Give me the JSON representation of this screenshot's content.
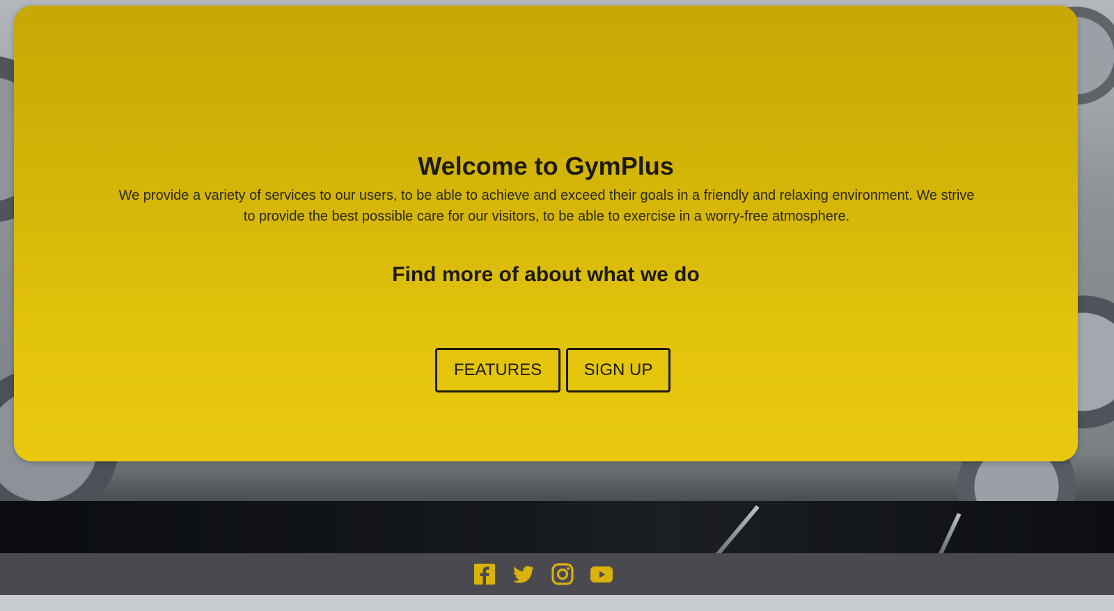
{
  "hero": {
    "title": "Welcome to GymPlus",
    "description": "We provide a variety of services to our users, to be able to achieve and exceed their goals in a friendly and relaxing environment. We strive to provide the best possible care for our visitors, to be able to exercise in a worry-free atmosphere.",
    "subtitle": "Find more of about what we do",
    "buttons": {
      "features": "FEATURES",
      "signup": "SIGN UP"
    }
  },
  "footer": {
    "social": [
      {
        "name": "facebook-icon"
      },
      {
        "name": "twitter-icon"
      },
      {
        "name": "instagram-icon"
      },
      {
        "name": "youtube-icon"
      }
    ]
  },
  "colors": {
    "hero_yellow": "#dcbc0a",
    "text_dark": "#1d1a12",
    "footer_bg": "#4b4950",
    "icon_gold": "#d9b20c"
  }
}
